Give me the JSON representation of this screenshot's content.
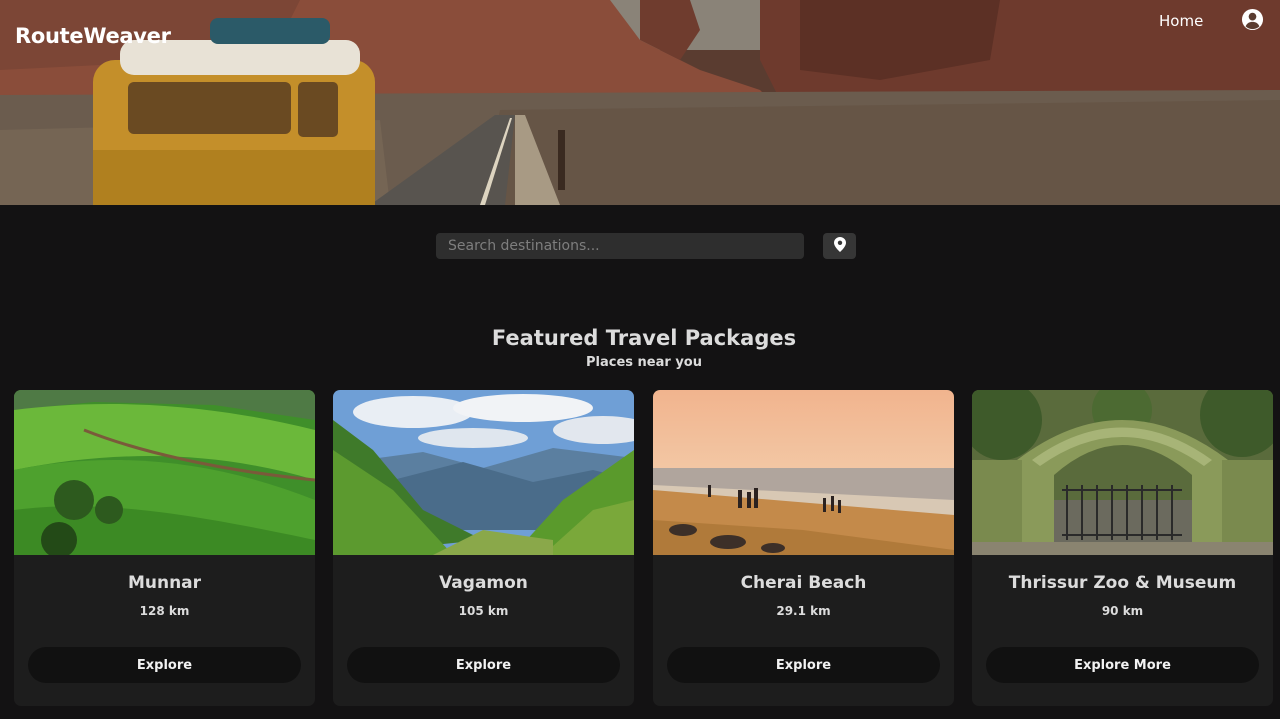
{
  "brand": {
    "name": "RouteWeaver"
  },
  "nav": {
    "home_label": "Home",
    "account_icon": "user-circle-icon"
  },
  "search": {
    "placeholder": "Search destinations...",
    "value": "",
    "location_icon": "map-pin-icon"
  },
  "featured": {
    "title": "Featured Travel Packages",
    "subtitle": "Places near you",
    "cards": [
      {
        "name": "Munnar",
        "distance": "128 km",
        "button": "Explore"
      },
      {
        "name": "Vagamon",
        "distance": "105 km",
        "button": "Explore"
      },
      {
        "name": "Cherai Beach",
        "distance": "29.1 km",
        "button": "Explore"
      },
      {
        "name": "Thrissur Zoo & Museum",
        "distance": "90 km",
        "button": "Explore More"
      }
    ]
  },
  "colors": {
    "page_background": "#131213",
    "card_background": "#1d1d1d",
    "button_background": "#111111",
    "search_background": "#2e2e2e"
  }
}
